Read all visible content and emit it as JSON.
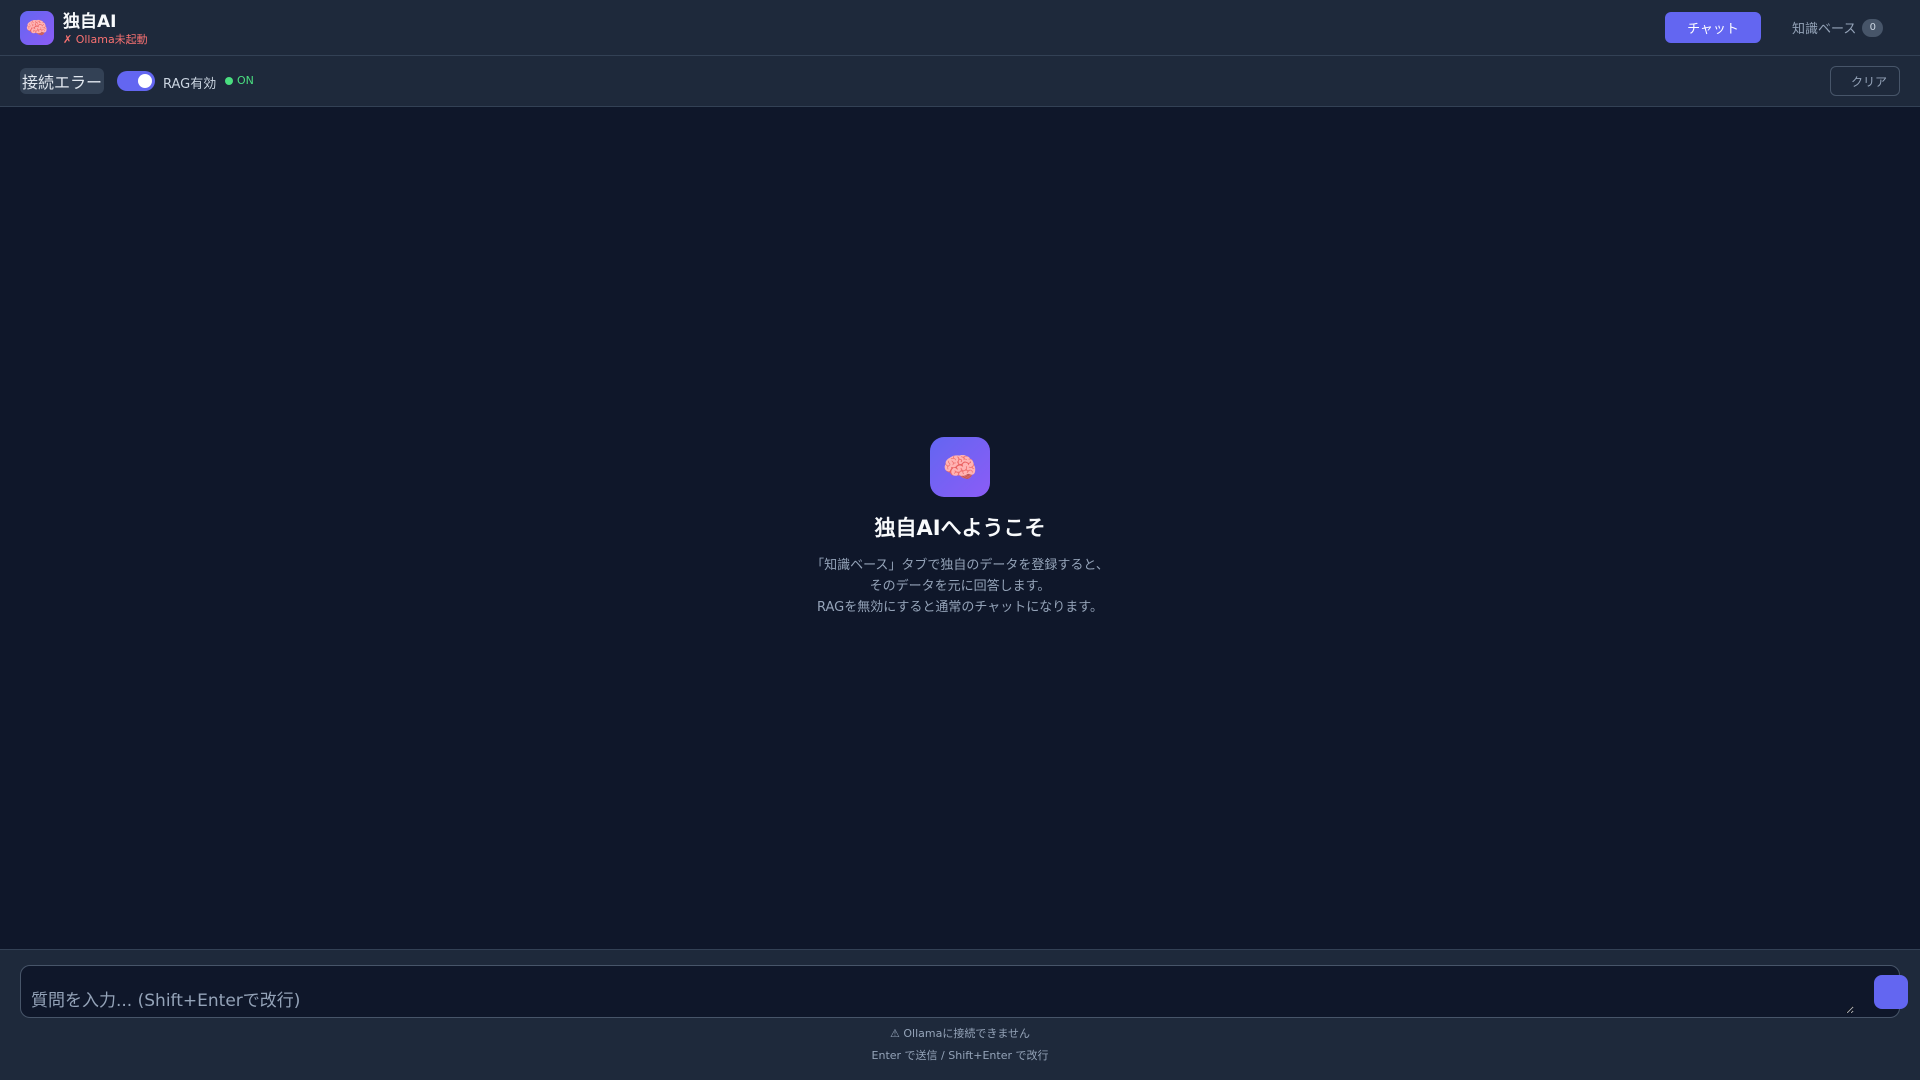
{
  "header": {
    "logo_icon": "brain-icon",
    "title": "独自AI",
    "status": "✗ Ollama未起動",
    "tabs": {
      "chat_label": "チャット",
      "kb_label": "知識ベース",
      "kb_count": "0"
    }
  },
  "toolbar": {
    "connection_status": "接続エラー",
    "rag_label": "RAG有効",
    "rag_state": "ON",
    "rag_enabled": true,
    "clear_label": "クリア"
  },
  "welcome": {
    "icon": "brain-icon",
    "title": "独自AIへようこそ",
    "lines": [
      "「知識ベース」タブで独自のデータを登録すると、",
      "そのデータを元に回答します。",
      "RAGを無効にすると通常のチャットになります。"
    ]
  },
  "composer": {
    "placeholder": "質問を入力... (Shift+Enterで改行)",
    "warning": "⚠ Ollamaに接続できません",
    "hint": "Enter で送信 / Shift+Enter で改行"
  },
  "colors": {
    "accent": "#6366f1",
    "error": "#f87171",
    "success": "#4ade80",
    "background": "#0f172a",
    "surface": "#1e293b"
  }
}
